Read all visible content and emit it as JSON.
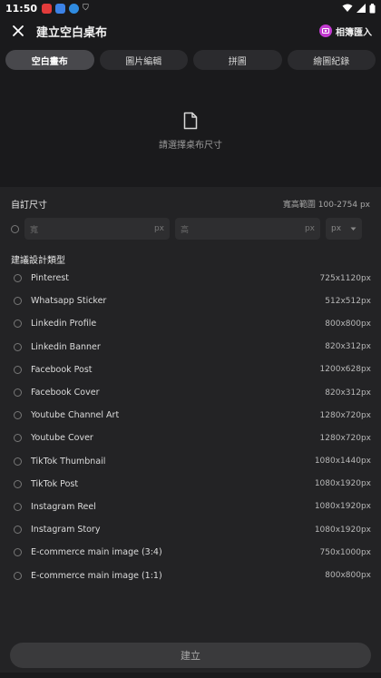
{
  "status_bar": {
    "time": "11:50",
    "battery_level": "▮"
  },
  "app_bar": {
    "title": "建立空白桌布",
    "album_import_label": "相簿匯入",
    "close_icon": "close-icon",
    "album_icon_color": "#c23ad0"
  },
  "tabs": [
    {
      "label": "空白畫布",
      "active": true
    },
    {
      "label": "圖片編輯",
      "active": false
    },
    {
      "label": "拼圖",
      "active": false
    },
    {
      "label": "繪圖紀錄",
      "active": false
    }
  ],
  "preview": {
    "icon": "file-icon",
    "hint": "請選擇桌布尺寸"
  },
  "custom_size": {
    "title": "自訂尺寸",
    "range": "寬高範圍 100-2754 px",
    "width_placeholder": "寬",
    "height_placeholder": "高",
    "unit_suffix": "px",
    "unit_select_value": "px"
  },
  "suggested": {
    "title": "建議設計類型",
    "items": [
      {
        "name": "Pinterest",
        "size": "725x1120px"
      },
      {
        "name": "Whatsapp Sticker",
        "size": "512x512px"
      },
      {
        "name": "Linkedin Profile",
        "size": "800x800px"
      },
      {
        "name": "Linkedin Banner",
        "size": "820x312px"
      },
      {
        "name": "Facebook Post",
        "size": "1200x628px"
      },
      {
        "name": "Facebook Cover",
        "size": "820x312px"
      },
      {
        "name": "Youtube Channel Art",
        "size": "1280x720px"
      },
      {
        "name": "Youtube Cover",
        "size": "1280x720px"
      },
      {
        "name": "TikTok Thumbnail",
        "size": "1080x1440px"
      },
      {
        "name": "TikTok Post",
        "size": "1080x1920px"
      },
      {
        "name": "Instagram Reel",
        "size": "1080x1920px"
      },
      {
        "name": "Instagram Story",
        "size": "1080x1920px"
      },
      {
        "name": "E-commerce main image (3:4)",
        "size": "750x1000px"
      },
      {
        "name": "E-commerce main image (1:1)",
        "size": "800x800px"
      }
    ]
  },
  "footer": {
    "create_label": "建立"
  }
}
